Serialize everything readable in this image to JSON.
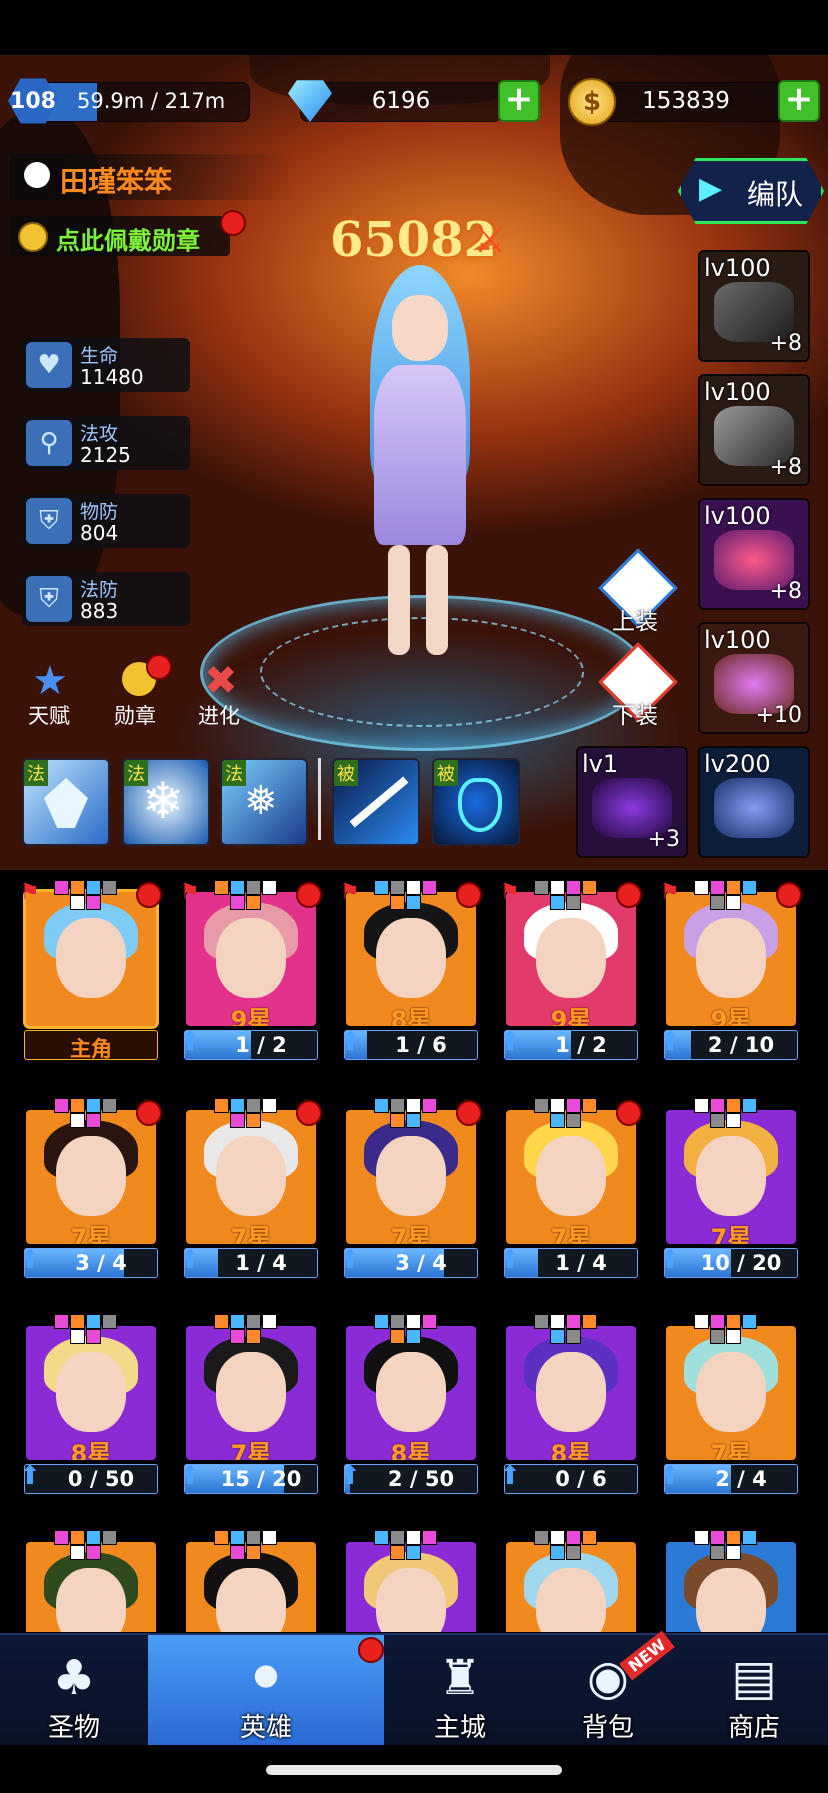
{
  "player": {
    "level": "108",
    "exp": "59.9m / 217m",
    "exp_fraction": 0.276,
    "name": "田瑾笨笨"
  },
  "currency": {
    "gems": "6196",
    "gold": "153839"
  },
  "medal_prompt": "点此佩戴勋章",
  "team_button": "编队",
  "power": "65082",
  "stats": [
    {
      "label": "生命",
      "value": "11480",
      "icon": "heart-icon"
    },
    {
      "label": "法攻",
      "value": "2125",
      "icon": "wand-icon"
    },
    {
      "label": "物防",
      "value": "804",
      "icon": "sword-shield-icon"
    },
    {
      "label": "法防",
      "value": "883",
      "icon": "magic-shield-icon"
    }
  ],
  "actions": {
    "talent": "天赋",
    "medal": "勋章",
    "evolve": "进化",
    "equip_on": "上装",
    "equip_off": "下装"
  },
  "equipment": [
    {
      "level": "lv100",
      "plus": "+8"
    },
    {
      "level": "lv100",
      "plus": "+8"
    },
    {
      "level": "lv100",
      "plus": "+8"
    },
    {
      "level": "lv100",
      "plus": "+10"
    },
    {
      "level": "lv1",
      "plus": "+3"
    },
    {
      "level": "lv200",
      "plus": ""
    }
  ],
  "skills": [
    "法",
    "法",
    "法",
    "被",
    "被"
  ],
  "heroes": [
    {
      "stars": "",
      "count": "主角",
      "fraction": 0,
      "bg": "#f08a1f",
      "hair": "#7ecbf6",
      "selected": true,
      "flag": true,
      "dot": true
    },
    {
      "stars": "9星",
      "count": "1 / 2",
      "fraction": 0.5,
      "bg": "#e2328c",
      "hair": "#e89aa8",
      "flag": true,
      "dot": true
    },
    {
      "stars": "8星",
      "count": "1 / 6",
      "fraction": 0.17,
      "bg": "#f08a1f",
      "hair": "#151515",
      "flag": true,
      "dot": true
    },
    {
      "stars": "9星",
      "count": "1 / 2",
      "fraction": 0.5,
      "bg": "#e23a6a",
      "hair": "#ffffff",
      "flag": true,
      "dot": true
    },
    {
      "stars": "9星",
      "count": "2 / 10",
      "fraction": 0.2,
      "bg": "#f08a1f",
      "hair": "#c9a0e6",
      "flag": true,
      "dot": true
    },
    {
      "stars": "7星",
      "count": "3 / 4",
      "fraction": 0.75,
      "bg": "#f08a1f",
      "hair": "#2a1410",
      "dot": true
    },
    {
      "stars": "7星",
      "count": "1 / 4",
      "fraction": 0.25,
      "bg": "#f08a1f",
      "hair": "#e8e8e8",
      "dot": true
    },
    {
      "stars": "7星",
      "count": "3 / 4",
      "fraction": 0.75,
      "bg": "#f08a1f",
      "hair": "#3a2a8a",
      "dot": true
    },
    {
      "stars": "7星",
      "count": "1 / 4",
      "fraction": 0.25,
      "bg": "#f08a1f",
      "hair": "#ffd54a",
      "dot": true
    },
    {
      "stars": "7星",
      "count": "10 / 20",
      "fraction": 0.5,
      "bg": "#8a2bd6",
      "hair": "#f2b040"
    },
    {
      "stars": "8星",
      "count": "0 / 50",
      "fraction": 0,
      "bg": "#8a2bd6",
      "hair": "#f4d98a"
    },
    {
      "stars": "7星",
      "count": "15 / 20",
      "fraction": 0.75,
      "bg": "#8a2bd6",
      "hair": "#1a1a1a"
    },
    {
      "stars": "8星",
      "count": "2 / 50",
      "fraction": 0.04,
      "bg": "#8a2bd6",
      "hair": "#111111"
    },
    {
      "stars": "8星",
      "count": "0 / 6",
      "fraction": 0,
      "bg": "#8a2bd6",
      "hair": "#5a2fc2"
    },
    {
      "stars": "7星",
      "count": "2 / 4",
      "fraction": 0.5,
      "bg": "#f08a1f",
      "hair": "#9fe0dc"
    },
    {
      "stars": "",
      "count": "",
      "fraction": 0,
      "bg": "#f08a1f",
      "hair": "#2f4a1c"
    },
    {
      "stars": "",
      "count": "",
      "fraction": 0,
      "bg": "#f08a1f",
      "hair": "#111111"
    },
    {
      "stars": "",
      "count": "",
      "fraction": 0,
      "bg": "#8a2bd6",
      "hair": "#f0c878"
    },
    {
      "stars": "",
      "count": "",
      "fraction": 0,
      "bg": "#f08a1f",
      "hair": "#9fd8ee"
    },
    {
      "stars": "",
      "count": "",
      "fraction": 0,
      "bg": "#2a7ad6",
      "hair": "#7a4a2a"
    }
  ],
  "nav": [
    {
      "label": "圣物",
      "icon": "clover-icon"
    },
    {
      "label": "英雄",
      "icon": "hero-helmet-icon",
      "active": true
    },
    {
      "label": "主城",
      "icon": "castle-icon"
    },
    {
      "label": "背包",
      "icon": "backpack-icon",
      "badge": "NEW"
    },
    {
      "label": "商店",
      "icon": "cart-icon"
    }
  ]
}
